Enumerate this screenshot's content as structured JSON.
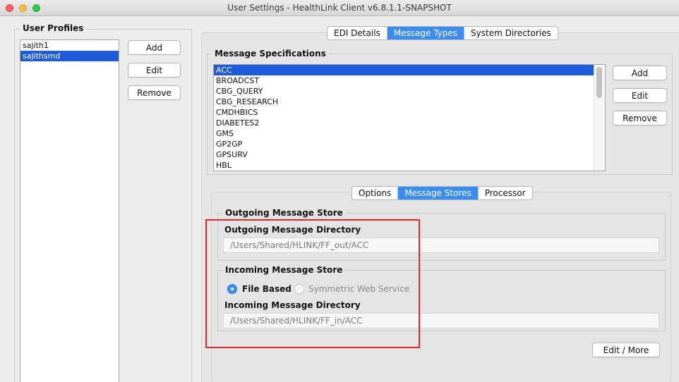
{
  "window": {
    "title": "User Settings - HealthLink Client v6.8.1.1-SNAPSHOT",
    "controls": [
      "close-icon",
      "minimize-icon",
      "maximize-icon"
    ]
  },
  "user_profiles": {
    "legend": "User Profiles",
    "items": [
      "sajith1",
      "sajithsmd"
    ],
    "selected_index": 1,
    "add_label": "Add",
    "edit_label": "Edit",
    "remove_label": "Remove"
  },
  "main_tabs": {
    "tabs": [
      "EDI Details",
      "Message Types",
      "System Directories"
    ],
    "active": "Message Types"
  },
  "message_specs": {
    "legend": "Message Specifications",
    "items": [
      "ACC",
      "BROADCST",
      "CBG_QUERY",
      "CBG_RESEARCH",
      "CMDHBICS",
      "DIABETES2",
      "GMS",
      "GP2GP",
      "GPSURV",
      "HBL"
    ],
    "selected_index": 0,
    "add_label": "Add",
    "edit_label": "Edit",
    "remove_label": "Remove"
  },
  "sub_tabs": {
    "tabs": [
      "Options",
      "Message Stores",
      "Processor"
    ],
    "active": "Message Stores"
  },
  "outgoing": {
    "legend": "Outgoing Message Store",
    "dir_label": "Outgoing Message Directory",
    "dir_value": "/Users/Shared/HLINK/FF_out/ACC"
  },
  "incoming": {
    "legend": "Incoming Message Store",
    "radio_file": "File Based",
    "radio_ws": "Symmetric Web Service",
    "selected": "File Based",
    "dir_label": "Incoming Message Directory",
    "dir_value": "/Users/Shared/HLINK/FF_in/ACC"
  },
  "edit_more_label": "Edit / More",
  "colors": {
    "accent": "#3a8df6",
    "list_selection": "#1f5cdb",
    "annotation": "#e8272a"
  }
}
